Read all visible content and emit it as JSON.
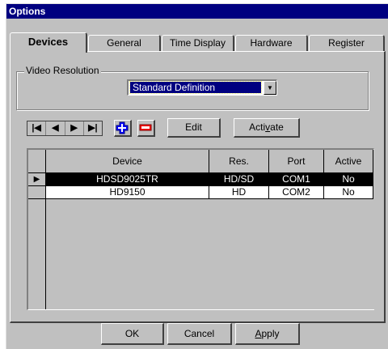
{
  "window": {
    "title": "Options"
  },
  "tabs": [
    {
      "label": "Devices",
      "active": true
    },
    {
      "label": "General",
      "active": false
    },
    {
      "label": "Time Display",
      "active": false
    },
    {
      "label": "Hardware",
      "active": false
    },
    {
      "label": "Register",
      "active": false
    }
  ],
  "video_resolution": {
    "group_label": "Video Resolution",
    "selected": "Standard Definition"
  },
  "toolbar": {
    "nav_icons": [
      "first-record-icon",
      "prev-record-icon",
      "next-record-icon",
      "last-record-icon"
    ],
    "add_icon": "plus-icon",
    "remove_icon": "minus-icon",
    "edit_label": "Edit",
    "activate_label": "Activate",
    "activate_mnemonic": "v"
  },
  "table": {
    "columns": [
      "Device",
      "Res.",
      "Port",
      "Active"
    ],
    "rows": [
      {
        "device": "HDSD9025TR",
        "res": "HD/SD",
        "port": "COM1",
        "active": "No",
        "selected": true
      },
      {
        "device": "HD9150",
        "res": "HD",
        "port": "COM2",
        "active": "No",
        "selected": false
      }
    ]
  },
  "footer": {
    "ok_label": "OK",
    "cancel_label": "Cancel",
    "apply_label": "Apply",
    "apply_mnemonic": "A"
  },
  "colors": {
    "titlebar": "#000080",
    "face": "#c0c0c0",
    "add_icon": "#0000ff",
    "remove_icon": "#ff0000"
  }
}
